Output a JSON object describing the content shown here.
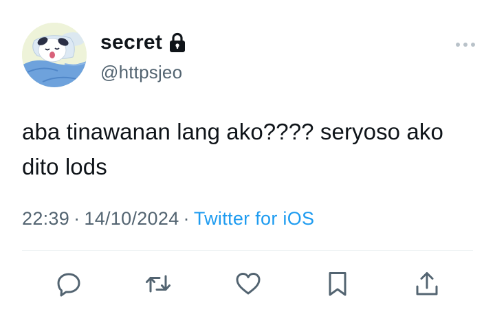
{
  "author": {
    "display_name": "secret",
    "handle": "@httpsjeo",
    "protected_icon": "lock-icon",
    "avatar_icon": "sleeping-character-avatar"
  },
  "tweet": {
    "text": "aba tinawanan lang ako???? seryoso ako dito lods",
    "time": "22:39",
    "separator": "·",
    "date": "14/10/2024",
    "source": "Twitter for iOS"
  },
  "actions": [
    {
      "name": "reply",
      "icon": "reply-icon"
    },
    {
      "name": "retweet",
      "icon": "retweet-icon"
    },
    {
      "name": "like",
      "icon": "heart-icon"
    },
    {
      "name": "bookmark",
      "icon": "bookmark-icon"
    },
    {
      "name": "share",
      "icon": "share-icon"
    }
  ],
  "colors": {
    "text": "#0f1419",
    "secondary": "#536471",
    "link": "#1d9bf0",
    "divider": "#eff3f4",
    "more_dots": "#b9c2c9"
  }
}
